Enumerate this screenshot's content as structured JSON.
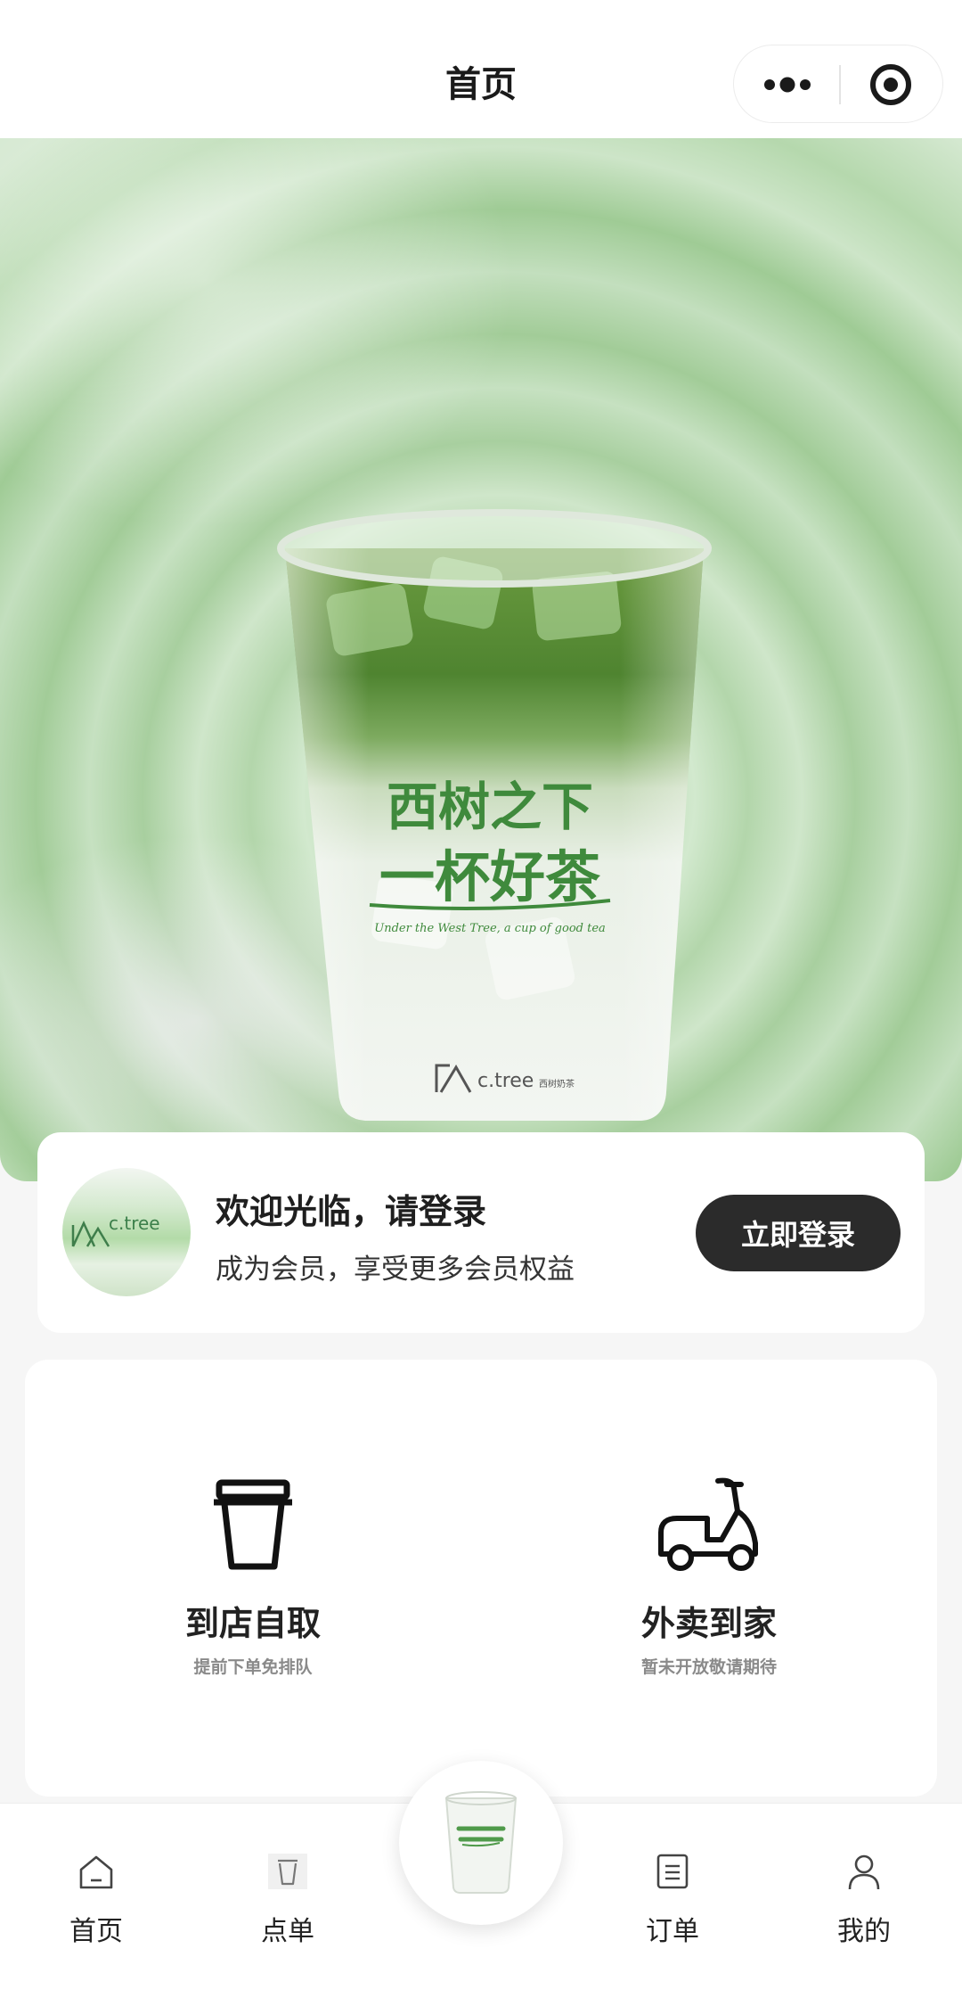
{
  "nav": {
    "title": "首页",
    "more_icon": "ellipsis-icon",
    "close_icon": "target-circle-icon"
  },
  "hero": {
    "cup_text_line1": "西树之下",
    "cup_text_line2": "一杯好茶",
    "cup_tagline": "Under the West Tree, a cup of good tea",
    "cup_brand": "c.tree",
    "cup_brand_cn": "西树奶茶",
    "colors": {
      "matcha": "#6fa457",
      "ring_light": "#d7ecd3",
      "ring_dark": "#a2cc98"
    }
  },
  "login": {
    "avatar_brand": "c.tree",
    "title": "欢迎光临，请登录",
    "subtitle": "成为会员，享受更多会员权益",
    "button": "立即登录"
  },
  "services": [
    {
      "title": "到店自取",
      "desc": "提前下单免排队",
      "icon": "cup-icon"
    },
    {
      "title": "外卖到家",
      "desc": "暂未开放敬请期待",
      "icon": "scooter-icon"
    }
  ],
  "tabs": [
    {
      "label": "首页",
      "icon": "home-icon"
    },
    {
      "label": "点单",
      "icon": "cup-icon"
    },
    {
      "label": "",
      "icon": "drink-center-icon"
    },
    {
      "label": "订单",
      "icon": "order-list-icon"
    },
    {
      "label": "我的",
      "icon": "user-icon"
    }
  ],
  "colors": {
    "button_dark": "#2b2b2b",
    "page_bg": "#f6f6f6"
  }
}
